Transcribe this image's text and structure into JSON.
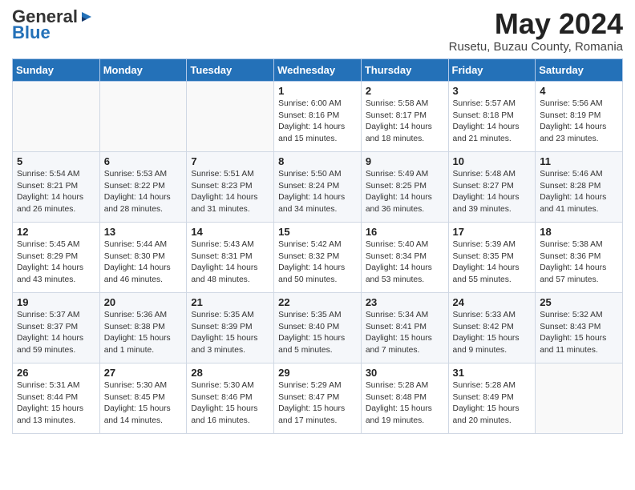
{
  "header": {
    "logo_general": "General",
    "logo_blue": "Blue",
    "month_title": "May 2024",
    "subtitle": "Rusetu, Buzau County, Romania"
  },
  "calendar": {
    "days_of_week": [
      "Sunday",
      "Monday",
      "Tuesday",
      "Wednesday",
      "Thursday",
      "Friday",
      "Saturday"
    ],
    "weeks": [
      [
        {
          "day": "",
          "info": ""
        },
        {
          "day": "",
          "info": ""
        },
        {
          "day": "",
          "info": ""
        },
        {
          "day": "1",
          "info": "Sunrise: 6:00 AM\nSunset: 8:16 PM\nDaylight: 14 hours\nand 15 minutes."
        },
        {
          "day": "2",
          "info": "Sunrise: 5:58 AM\nSunset: 8:17 PM\nDaylight: 14 hours\nand 18 minutes."
        },
        {
          "day": "3",
          "info": "Sunrise: 5:57 AM\nSunset: 8:18 PM\nDaylight: 14 hours\nand 21 minutes."
        },
        {
          "day": "4",
          "info": "Sunrise: 5:56 AM\nSunset: 8:19 PM\nDaylight: 14 hours\nand 23 minutes."
        }
      ],
      [
        {
          "day": "5",
          "info": "Sunrise: 5:54 AM\nSunset: 8:21 PM\nDaylight: 14 hours\nand 26 minutes."
        },
        {
          "day": "6",
          "info": "Sunrise: 5:53 AM\nSunset: 8:22 PM\nDaylight: 14 hours\nand 28 minutes."
        },
        {
          "day": "7",
          "info": "Sunrise: 5:51 AM\nSunset: 8:23 PM\nDaylight: 14 hours\nand 31 minutes."
        },
        {
          "day": "8",
          "info": "Sunrise: 5:50 AM\nSunset: 8:24 PM\nDaylight: 14 hours\nand 34 minutes."
        },
        {
          "day": "9",
          "info": "Sunrise: 5:49 AM\nSunset: 8:25 PM\nDaylight: 14 hours\nand 36 minutes."
        },
        {
          "day": "10",
          "info": "Sunrise: 5:48 AM\nSunset: 8:27 PM\nDaylight: 14 hours\nand 39 minutes."
        },
        {
          "day": "11",
          "info": "Sunrise: 5:46 AM\nSunset: 8:28 PM\nDaylight: 14 hours\nand 41 minutes."
        }
      ],
      [
        {
          "day": "12",
          "info": "Sunrise: 5:45 AM\nSunset: 8:29 PM\nDaylight: 14 hours\nand 43 minutes."
        },
        {
          "day": "13",
          "info": "Sunrise: 5:44 AM\nSunset: 8:30 PM\nDaylight: 14 hours\nand 46 minutes."
        },
        {
          "day": "14",
          "info": "Sunrise: 5:43 AM\nSunset: 8:31 PM\nDaylight: 14 hours\nand 48 minutes."
        },
        {
          "day": "15",
          "info": "Sunrise: 5:42 AM\nSunset: 8:32 PM\nDaylight: 14 hours\nand 50 minutes."
        },
        {
          "day": "16",
          "info": "Sunrise: 5:40 AM\nSunset: 8:34 PM\nDaylight: 14 hours\nand 53 minutes."
        },
        {
          "day": "17",
          "info": "Sunrise: 5:39 AM\nSunset: 8:35 PM\nDaylight: 14 hours\nand 55 minutes."
        },
        {
          "day": "18",
          "info": "Sunrise: 5:38 AM\nSunset: 8:36 PM\nDaylight: 14 hours\nand 57 minutes."
        }
      ],
      [
        {
          "day": "19",
          "info": "Sunrise: 5:37 AM\nSunset: 8:37 PM\nDaylight: 14 hours\nand 59 minutes."
        },
        {
          "day": "20",
          "info": "Sunrise: 5:36 AM\nSunset: 8:38 PM\nDaylight: 15 hours\nand 1 minute."
        },
        {
          "day": "21",
          "info": "Sunrise: 5:35 AM\nSunset: 8:39 PM\nDaylight: 15 hours\nand 3 minutes."
        },
        {
          "day": "22",
          "info": "Sunrise: 5:35 AM\nSunset: 8:40 PM\nDaylight: 15 hours\nand 5 minutes."
        },
        {
          "day": "23",
          "info": "Sunrise: 5:34 AM\nSunset: 8:41 PM\nDaylight: 15 hours\nand 7 minutes."
        },
        {
          "day": "24",
          "info": "Sunrise: 5:33 AM\nSunset: 8:42 PM\nDaylight: 15 hours\nand 9 minutes."
        },
        {
          "day": "25",
          "info": "Sunrise: 5:32 AM\nSunset: 8:43 PM\nDaylight: 15 hours\nand 11 minutes."
        }
      ],
      [
        {
          "day": "26",
          "info": "Sunrise: 5:31 AM\nSunset: 8:44 PM\nDaylight: 15 hours\nand 13 minutes."
        },
        {
          "day": "27",
          "info": "Sunrise: 5:30 AM\nSunset: 8:45 PM\nDaylight: 15 hours\nand 14 minutes."
        },
        {
          "day": "28",
          "info": "Sunrise: 5:30 AM\nSunset: 8:46 PM\nDaylight: 15 hours\nand 16 minutes."
        },
        {
          "day": "29",
          "info": "Sunrise: 5:29 AM\nSunset: 8:47 PM\nDaylight: 15 hours\nand 17 minutes."
        },
        {
          "day": "30",
          "info": "Sunrise: 5:28 AM\nSunset: 8:48 PM\nDaylight: 15 hours\nand 19 minutes."
        },
        {
          "day": "31",
          "info": "Sunrise: 5:28 AM\nSunset: 8:49 PM\nDaylight: 15 hours\nand 20 minutes."
        },
        {
          "day": "",
          "info": ""
        }
      ]
    ]
  }
}
